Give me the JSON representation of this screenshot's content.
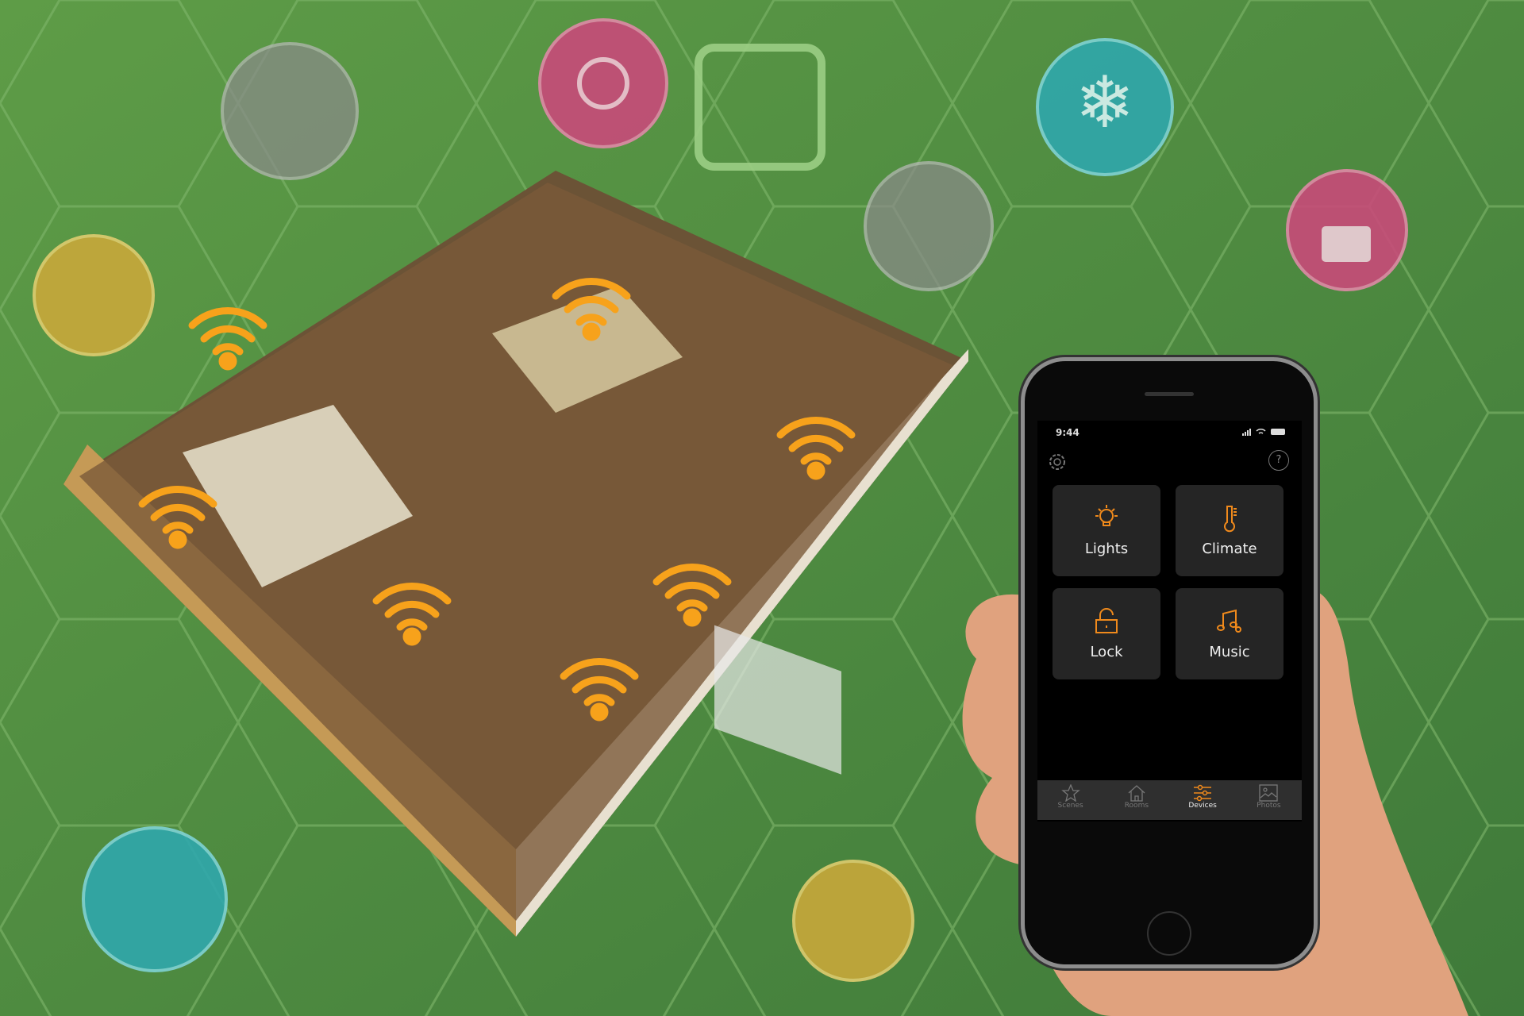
{
  "phone": {
    "status": {
      "time": "9:44",
      "indicators": "signal wifi battery"
    },
    "header": {
      "settings_icon": "gear-icon",
      "help_label": "?"
    },
    "tiles": [
      {
        "label": "Lights",
        "icon": "lightbulb-icon"
      },
      {
        "label": "Climate",
        "icon": "thermometer-icon"
      },
      {
        "label": "Lock",
        "icon": "padlock-icon"
      },
      {
        "label": "Music",
        "icon": "music-notes-icon"
      }
    ],
    "tabs": [
      {
        "label": "Scenes",
        "icon": "star-icon",
        "active": false
      },
      {
        "label": "Rooms",
        "icon": "house-icon",
        "active": false
      },
      {
        "label": "Devices",
        "icon": "sliders-icon",
        "active": true
      },
      {
        "label": "Photos",
        "icon": "photo-icon",
        "active": false
      }
    ]
  },
  "colors": {
    "accent": "#f08a1c",
    "background": "#4e8a3e",
    "wifi": "#f7a21b"
  }
}
